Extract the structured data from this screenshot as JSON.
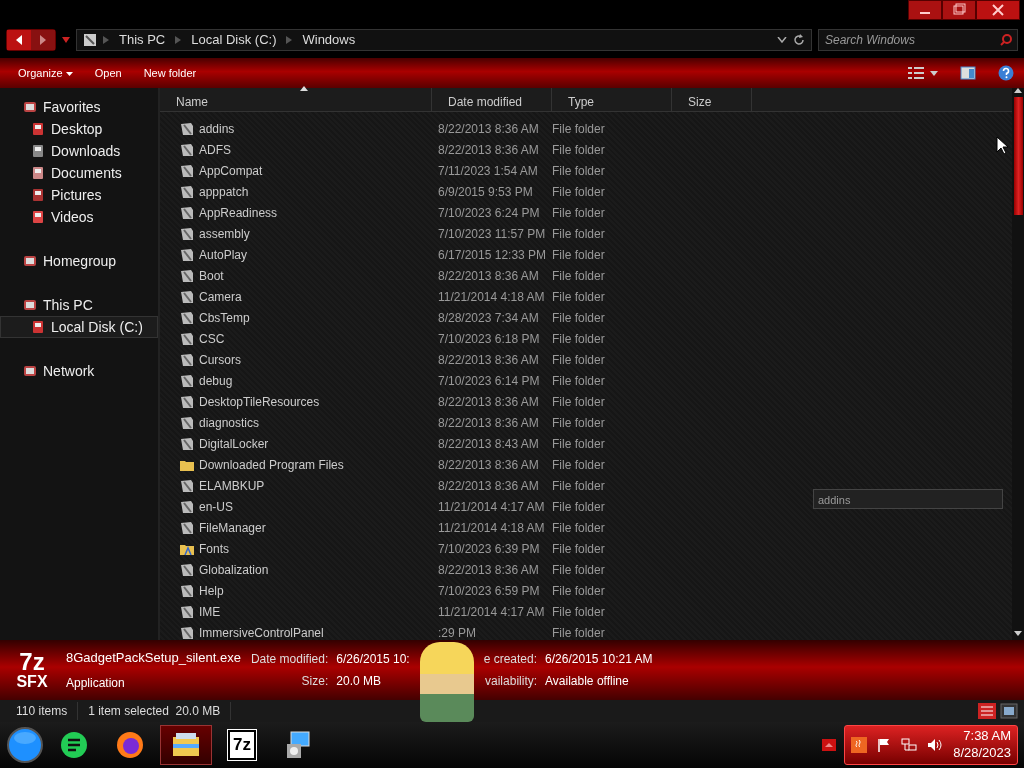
{
  "address_bar": {
    "crumbs": [
      "This PC",
      "Local Disk (C:)",
      "Windows"
    ],
    "search_placeholder": "Search Windows"
  },
  "toolbar": {
    "buttons": [
      {
        "label": "Organize",
        "dropdown": true
      },
      {
        "label": "Open",
        "dropdown": false
      },
      {
        "label": "New folder",
        "dropdown": false
      }
    ]
  },
  "sidebar": [
    {
      "label": "Favorites",
      "selected": false,
      "children": [
        {
          "label": "Desktop",
          "selected": false
        },
        {
          "label": "Downloads",
          "selected": false
        },
        {
          "label": "Documents",
          "selected": false
        },
        {
          "label": "Pictures",
          "selected": false
        },
        {
          "label": "Videos",
          "selected": false
        }
      ]
    },
    {
      "label": "Homegroup",
      "selected": false
    },
    {
      "label": "This PC",
      "selected": false,
      "children": [
        {
          "label": "Local Disk (C:)",
          "selected": true
        }
      ]
    },
    {
      "label": "Network",
      "selected": false
    }
  ],
  "table": {
    "columns": [
      "Name",
      "Date modified",
      "Type",
      "Size"
    ],
    "rows": [
      {
        "kind": "system",
        "name": "addins",
        "date": "8/22/2013 8:36 AM",
        "type": "File folder"
      },
      {
        "kind": "system",
        "name": "ADFS",
        "date": "8/22/2013 8:36 AM",
        "type": "File folder"
      },
      {
        "kind": "system",
        "name": "AppCompat",
        "date": "7/11/2023 1:54 AM",
        "type": "File folder"
      },
      {
        "kind": "system",
        "name": "apppatch",
        "date": "6/9/2015 9:53 PM",
        "type": "File folder"
      },
      {
        "kind": "system",
        "name": "AppReadiness",
        "date": "7/10/2023 6:24 PM",
        "type": "File folder"
      },
      {
        "kind": "system",
        "name": "assembly",
        "date": "7/10/2023 11:57 PM",
        "type": "File folder"
      },
      {
        "kind": "system",
        "name": "AutoPlay",
        "date": "6/17/2015 12:33 PM",
        "type": "File folder"
      },
      {
        "kind": "system",
        "name": "Boot",
        "date": "8/22/2013 8:36 AM",
        "type": "File folder"
      },
      {
        "kind": "system",
        "name": "Camera",
        "date": "11/21/2014 4:18 AM",
        "type": "File folder"
      },
      {
        "kind": "system",
        "name": "CbsTemp",
        "date": "8/28/2023 7:34 AM",
        "type": "File folder"
      },
      {
        "kind": "system",
        "name": "CSC",
        "date": "7/10/2023 6:18 PM",
        "type": "File folder"
      },
      {
        "kind": "system",
        "name": "Cursors",
        "date": "8/22/2013 8:36 AM",
        "type": "File folder"
      },
      {
        "kind": "system",
        "name": "debug",
        "date": "7/10/2023 6:14 PM",
        "type": "File folder"
      },
      {
        "kind": "system",
        "name": "DesktopTileResources",
        "date": "8/22/2013 8:36 AM",
        "type": "File folder"
      },
      {
        "kind": "system",
        "name": "diagnostics",
        "date": "8/22/2013 8:36 AM",
        "type": "File folder"
      },
      {
        "kind": "system",
        "name": "DigitalLocker",
        "date": "8/22/2013 8:43 AM",
        "type": "File folder"
      },
      {
        "kind": "plain",
        "name": "Downloaded Program Files",
        "date": "8/22/2013 8:36 AM",
        "type": "File folder"
      },
      {
        "kind": "system",
        "name": "ELAMBKUP",
        "date": "8/22/2013 8:36 AM",
        "type": "File folder"
      },
      {
        "kind": "system",
        "name": "en-US",
        "date": "11/21/2014 4:17 AM",
        "type": "File folder"
      },
      {
        "kind": "system",
        "name": "FileManager",
        "date": "11/21/2014 4:18 AM",
        "type": "File folder"
      },
      {
        "kind": "fonts",
        "name": "Fonts",
        "date": "7/10/2023 6:39 PM",
        "type": "File folder"
      },
      {
        "kind": "system",
        "name": "Globalization",
        "date": "8/22/2013 8:36 AM",
        "type": "File folder"
      },
      {
        "kind": "system",
        "name": "Help",
        "date": "7/10/2023 6:59 PM",
        "type": "File folder"
      },
      {
        "kind": "system",
        "name": "IME",
        "date": "11/21/2014 4:17 AM",
        "type": "File folder"
      },
      {
        "kind": "system",
        "name": "ImmersiveControlPanel",
        "date": ":29 PM",
        "type": "File folder"
      }
    ]
  },
  "type_ahead": "addins",
  "details": {
    "file_name": "8GadgetPackSetup_silent.exe",
    "file_type": "Application",
    "icon_text": [
      "7z",
      "SFX"
    ],
    "fields": [
      {
        "label": "Date modified:",
        "value": "6/26/2015 10:"
      },
      {
        "label": "Size:",
        "value": "20.0 MB"
      }
    ],
    "fields_right": [
      {
        "label": "e created:",
        "value": "6/26/2015 10:21 AM"
      },
      {
        "label": "vailability:",
        "value": "Available offline"
      }
    ]
  },
  "status_bar": {
    "count": "110 items",
    "selection": "1 item selected",
    "selection_size": "20.0 MB"
  },
  "taskbar": {
    "apps": [
      {
        "kind": "notes",
        "selected": false
      },
      {
        "kind": "firefox",
        "selected": false
      },
      {
        "kind": "explorer",
        "selected": true
      },
      {
        "kind": "archiver",
        "label": "7z",
        "selected": false
      },
      {
        "kind": "installer",
        "selected": false
      }
    ],
    "time": "7:38 AM",
    "date": "8/28/2023"
  }
}
